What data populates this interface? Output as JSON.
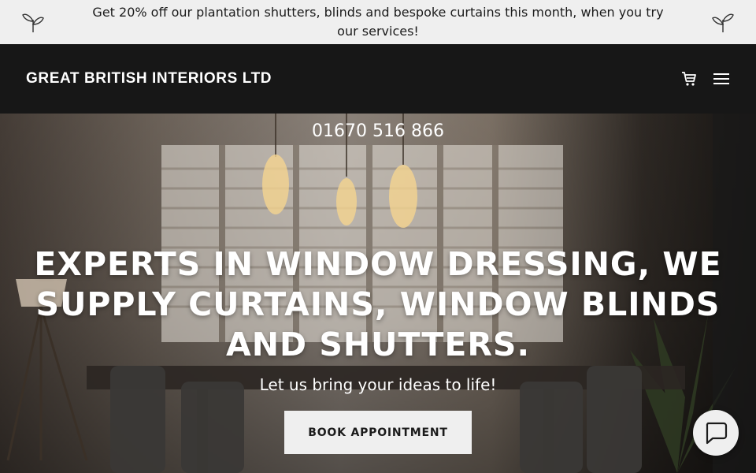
{
  "promo": {
    "text": "Get 20% off our plantation shutters, blinds and bespoke curtains this month, when you try our services!"
  },
  "header": {
    "brand": "GREAT BRITISH INTERIORS LTD"
  },
  "hero": {
    "phone": "01670 516 866",
    "headline": "EXPERTS IN WINDOW DRESSING, WE SUPPLY CURTAINS, WINDOW BLINDS AND SHUTTERS.",
    "tagline": "Let us bring your ideas to life!",
    "cta_label": "BOOK APPOINTMENT"
  },
  "icons": {
    "promo_left": "leaf-icon",
    "promo_right": "leaf-icon",
    "cart": "cart-icon",
    "menu": "hamburger-menu-icon",
    "chat": "chat-bubble-icon"
  },
  "colors": {
    "promo_bg": "#efefef",
    "header_bg": "#171717",
    "text_light": "#ffffff",
    "button_bg": "#efefef",
    "button_text": "#1b1b1b"
  }
}
